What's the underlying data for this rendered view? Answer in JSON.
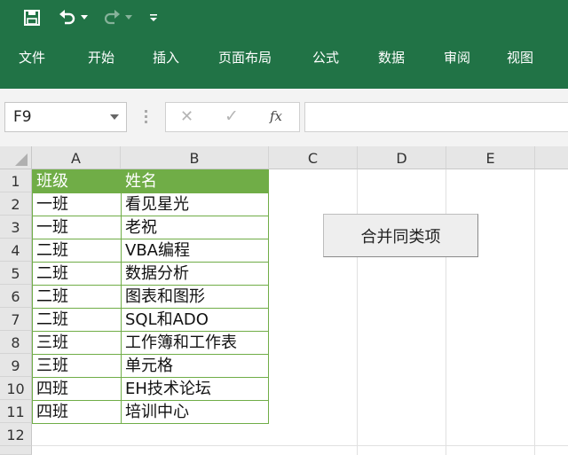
{
  "colors": {
    "ribbon": "#217346",
    "header_fill": "#70ad47",
    "table_border": "#70ad47"
  },
  "qat": {
    "icons": [
      "save-icon",
      "undo-icon",
      "redo-icon",
      "customize-icon"
    ]
  },
  "menu": {
    "items": [
      "文件",
      "开始",
      "插入",
      "页面布局",
      "公式",
      "数据",
      "审阅",
      "视图"
    ]
  },
  "formula_bar": {
    "name_box": "F9",
    "fx_label": "fx",
    "cancel_glyph": "✕",
    "enter_glyph": "✓",
    "formula": ""
  },
  "sheet": {
    "columns": [
      "A",
      "B",
      "C",
      "D",
      "E"
    ],
    "rows": [
      "1",
      "2",
      "3",
      "4",
      "5",
      "6",
      "7",
      "8",
      "9",
      "10",
      "11",
      "12"
    ],
    "header": {
      "a": "班级",
      "b": "姓名"
    },
    "data": [
      {
        "a": "一班",
        "b": "看见星光"
      },
      {
        "a": "一班",
        "b": "老祝"
      },
      {
        "a": "二班",
        "b": "VBA编程"
      },
      {
        "a": "二班",
        "b": "数据分析"
      },
      {
        "a": "二班",
        "b": "图表和图形"
      },
      {
        "a": "二班",
        "b": "SQL和ADO"
      },
      {
        "a": "三班",
        "b": "工作簿和工作表"
      },
      {
        "a": "三班",
        "b": "单元格"
      },
      {
        "a": "四班",
        "b": "EH技术论坛"
      },
      {
        "a": "四班",
        "b": "培训中心"
      }
    ]
  },
  "button": {
    "label": "合并同类项"
  }
}
